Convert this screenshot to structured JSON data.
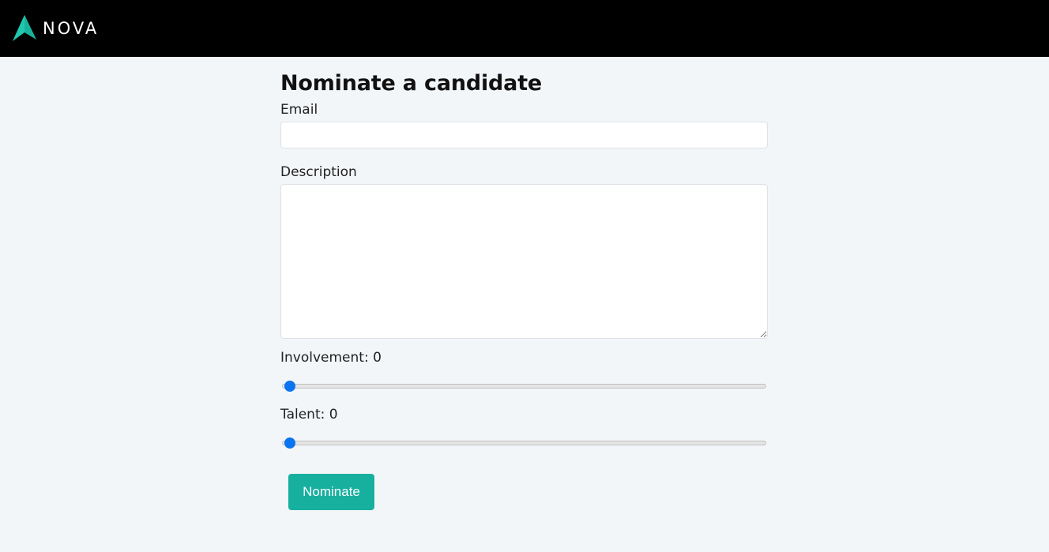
{
  "brand": {
    "name": "NOVA",
    "logo_colors": [
      "#1fc9b0",
      "#0f9a88"
    ]
  },
  "form": {
    "title": "Nominate a candidate",
    "email_label": "Email",
    "email_value": "",
    "description_label": "Description",
    "description_value": "",
    "involvement": {
      "label_prefix": "Involvement: ",
      "value": "0",
      "level": 0
    },
    "talent": {
      "label_prefix": "Talent: ",
      "value": "0",
      "level": 0
    },
    "submit_label": "Nominate"
  },
  "colors": {
    "navbar": "#000000",
    "background": "#f3f6f9",
    "button": "#17b09f",
    "slider_accent": "#0b74f0"
  }
}
